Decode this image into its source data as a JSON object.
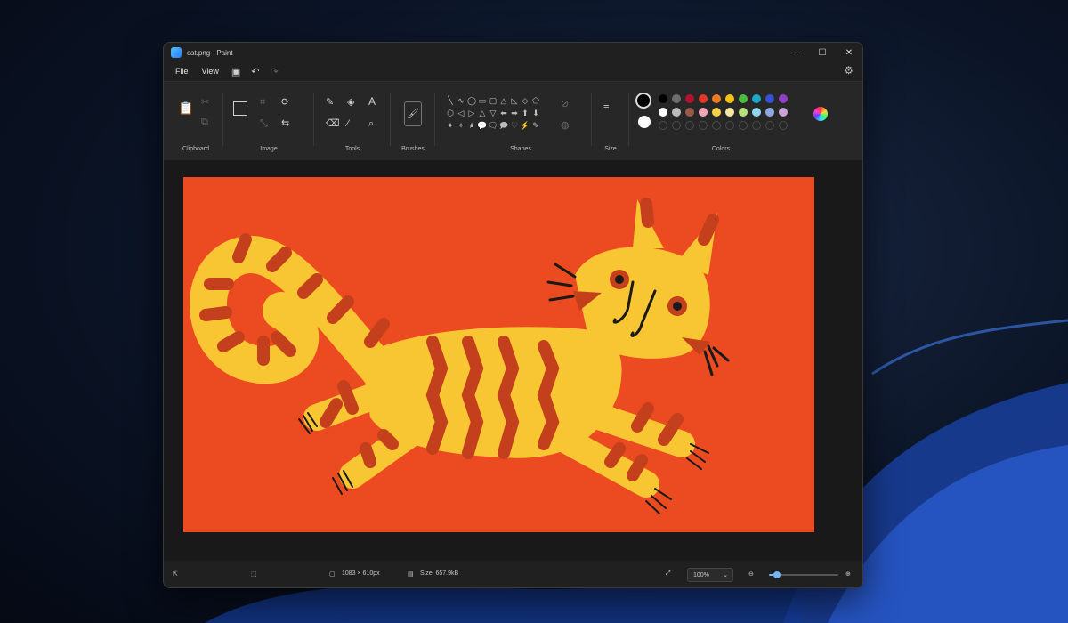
{
  "window": {
    "title": "cat.png - Paint"
  },
  "window_controls": {
    "minimize": "—",
    "maximize": "☐",
    "close": "✕"
  },
  "menu": {
    "file": "File",
    "view": "View",
    "save_icon": "floppy-icon",
    "undo_icon": "undo-icon",
    "redo_icon": "redo-icon"
  },
  "ribbon": {
    "clipboard_label": "Clipboard",
    "image_label": "Image",
    "tools_label": "Tools",
    "brushes_label": "Brushes",
    "shapes_label": "Shapes",
    "size_label": "Size",
    "colors_label": "Colors",
    "text_tool": "A",
    "shapes": [
      "╲",
      "∿",
      "◯",
      "▭",
      "▢",
      "△",
      "◺",
      "◇",
      "⬠",
      "⬡",
      "◁",
      "▷",
      "△",
      "▽",
      "⬅",
      "➡",
      "⬆",
      "⬇",
      "✦",
      "✧",
      "★",
      "💬",
      "🗨",
      "🗩",
      "♡",
      "⚡",
      "✎"
    ],
    "primary_color": "#000000",
    "secondary_color": "#ffffff",
    "palette_row1": [
      "#000000",
      "#6e6e6e",
      "#b3122f",
      "#e0392b",
      "#f07b22",
      "#f3c318",
      "#4dbb3f",
      "#1ba7c9",
      "#3a4fd1",
      "#8e3fc4"
    ],
    "palette_row2": [
      "#ffffff",
      "#bcbcbc",
      "#9a5a48",
      "#f2a4b8",
      "#f8d04a",
      "#f3e7a2",
      "#b6e07b",
      "#8fd6e8",
      "#8ea8dd",
      "#c7a3d8"
    ]
  },
  "status": {
    "canvas_size": "1083 × 610px",
    "file_size": "Size: 657.9kB",
    "zoom": "100%",
    "zoom_fraction": 0.1
  }
}
